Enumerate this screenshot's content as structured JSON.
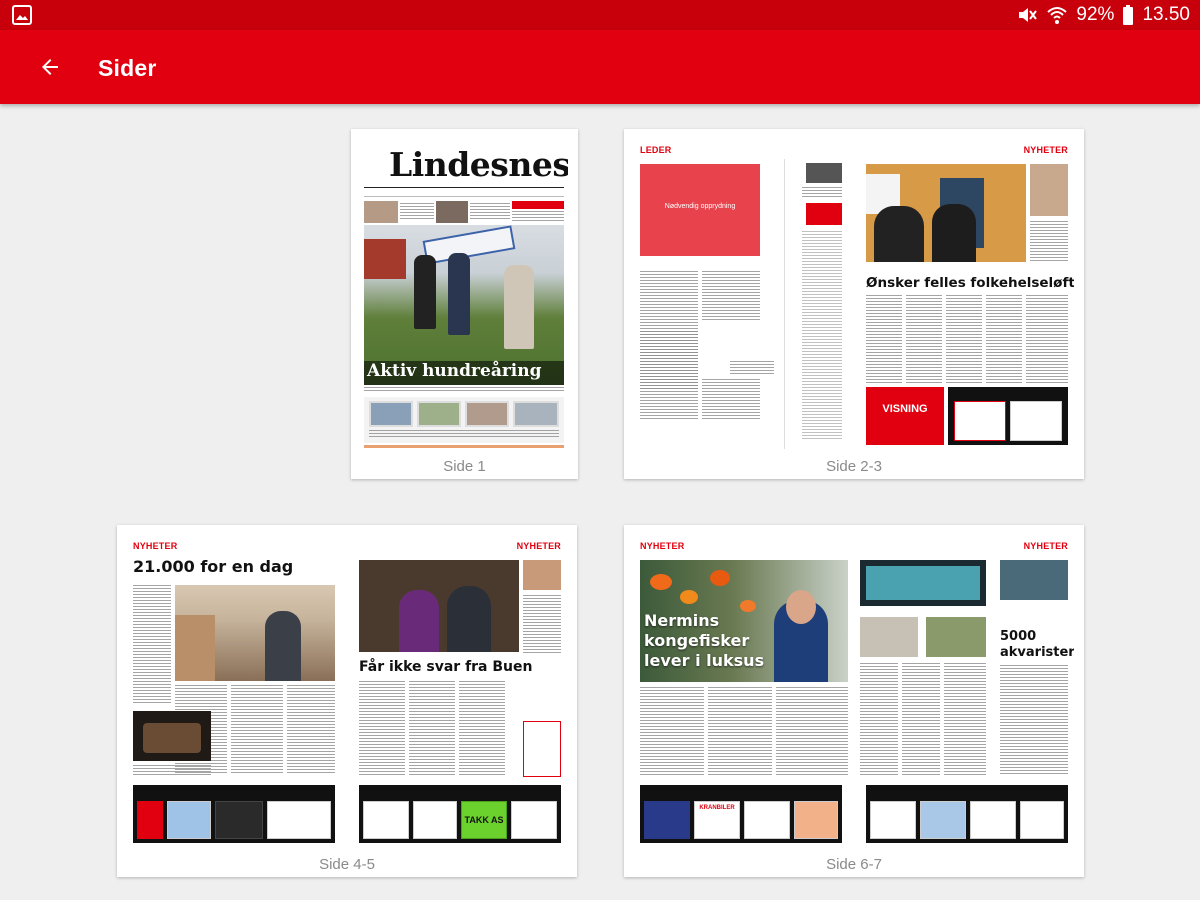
{
  "status": {
    "battery": "92%",
    "time": "13.50"
  },
  "appbar": {
    "title": "Sider"
  },
  "pages": [
    {
      "label": "Side 1",
      "masthead": "Lindesnes",
      "headline": "Aktiv hundreåring"
    },
    {
      "label": "Side 2-3",
      "left_section": "LEDER",
      "leader_box_text": "Nødvendig opprydning",
      "right_section": "NYHETER",
      "headline": "Ønsker felles folkehelseløft",
      "ad_text": "VISNING"
    },
    {
      "label": "Side 4-5",
      "left_section": "NYHETER",
      "right_section": "NYHETER",
      "left_headline": "21.000 for en dag",
      "right_headline": "Får ikke svar fra Buen",
      "ad_text": "TAKK AS"
    },
    {
      "label": "Side 6-7",
      "left_section": "NYHETER",
      "right_section": "NYHETER",
      "overlay_headline_1": "Nermins",
      "overlay_headline_2": "kongefisker",
      "overlay_headline_3": "lever i luksus",
      "side_headline_1": "5000",
      "side_headline_2": "akvarister",
      "ad_text": "KRANBILER"
    }
  ],
  "colors": {
    "status_bar": "#c8000c",
    "app_bar": "#e1000f",
    "background": "#efefef",
    "section_red": "#e1000f"
  },
  "icons": {
    "status_left": "image-icon",
    "back": "arrow-back-icon",
    "mute": "mute-icon",
    "wifi": "wifi-icon",
    "battery": "battery-icon"
  }
}
